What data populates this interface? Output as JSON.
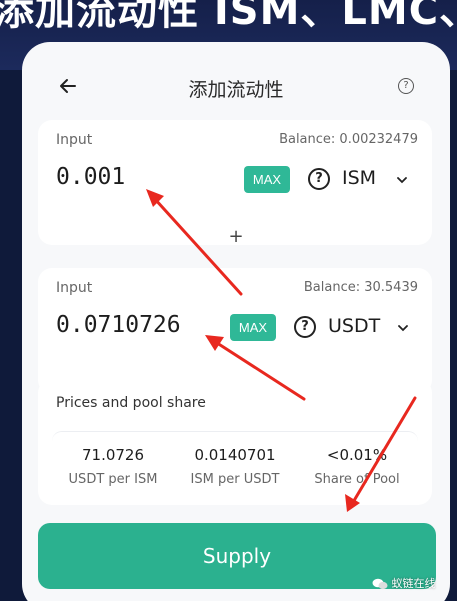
{
  "banner": {
    "text": "添加流动性 ISM、LMC、LMC"
  },
  "header": {
    "title": "添加流动性",
    "back_icon": "arrow-left-icon",
    "help_icon": "help-circle-icon"
  },
  "input_a": {
    "label": "Input",
    "balance": "Balance: 0.00232479",
    "amount": "0.001",
    "max_label": "MAX",
    "token_icon": "question-circle-icon",
    "token_symbol": "ISM"
  },
  "plus_sign": "+",
  "input_b": {
    "label": "Input",
    "balance": "Balance: 30.5439",
    "amount": "0.0710726",
    "max_label": "MAX",
    "token_icon": "question-circle-icon",
    "token_symbol": "USDT"
  },
  "pool_share": {
    "title": "Prices and pool share",
    "stats": [
      {
        "value": "71.0726",
        "label": "USDT per ISM"
      },
      {
        "value": "0.0140701",
        "label": "ISM per USDT"
      },
      {
        "value": "<0.01%",
        "label": "Share of Pool"
      }
    ]
  },
  "supply_button": {
    "label": "Supply"
  },
  "watermark": {
    "text": "蚁链在线"
  },
  "colors": {
    "accent": "#2bb18f",
    "max_badge": "#2fb897",
    "background": "#f7f8fa",
    "arrow": "#e8281f"
  }
}
